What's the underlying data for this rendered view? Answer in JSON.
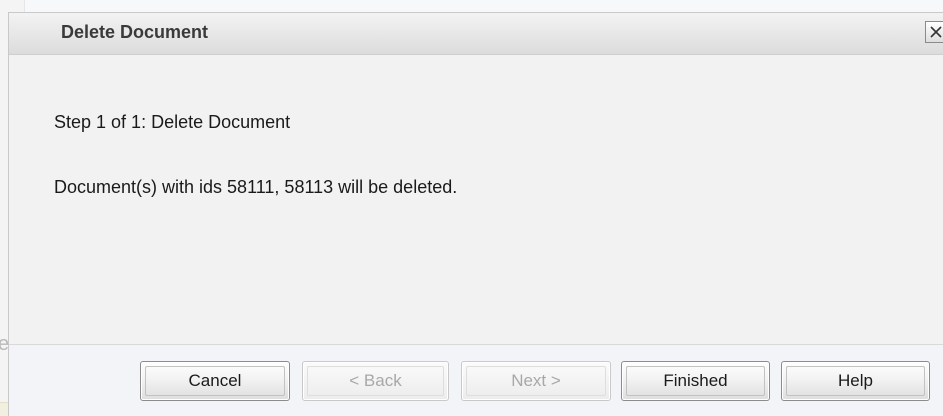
{
  "background": {
    "left_fragment_text": "ed"
  },
  "dialog": {
    "title": "Delete Document",
    "close_icon": "close-icon",
    "step_text": "Step 1 of 1: Delete Document",
    "message": "Document(s) with ids 58111, 58113 will be deleted."
  },
  "buttons": {
    "cancel": "Cancel",
    "back": "< Back",
    "next": "Next >",
    "finished": "Finished",
    "help": "Help"
  }
}
